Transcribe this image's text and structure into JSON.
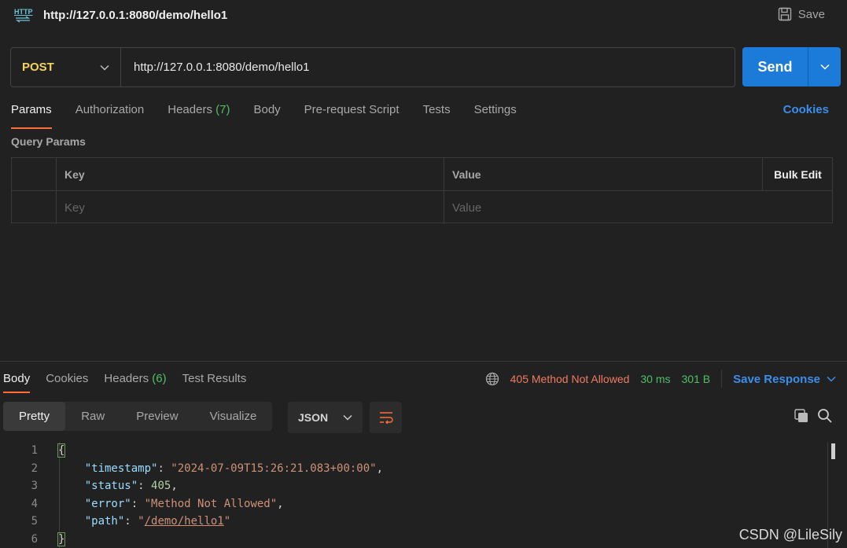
{
  "header": {
    "icon_text": "HTTP",
    "title": "http://127.0.0.1:8080/demo/hello1",
    "save_label": "Save"
  },
  "request": {
    "method": "POST",
    "url": "http://127.0.0.1:8080/demo/hello1",
    "send_label": "Send"
  },
  "req_tabs": {
    "params": "Params",
    "authorization": "Authorization",
    "headers": "Headers",
    "headers_count": "(7)",
    "body": "Body",
    "prerequest": "Pre-request Script",
    "tests": "Tests",
    "settings": "Settings"
  },
  "cookies_label": "Cookies",
  "query_params": {
    "title": "Query Params",
    "col_key": "Key",
    "col_value": "Value",
    "bulk_edit": "Bulk Edit",
    "key_placeholder": "Key",
    "value_placeholder": "Value"
  },
  "response": {
    "tabs": {
      "body": "Body",
      "cookies": "Cookies",
      "headers": "Headers",
      "headers_count": "(6)",
      "test_results": "Test Results"
    },
    "status": "405 Method Not Allowed",
    "time": "30 ms",
    "size": "301 B",
    "save_response": "Save Response",
    "views": {
      "pretty": "Pretty",
      "raw": "Raw",
      "preview": "Preview",
      "visualize": "Visualize"
    },
    "format": "JSON",
    "line_numbers": [
      "1",
      "2",
      "3",
      "4",
      "5",
      "6"
    ],
    "json": {
      "open": "{",
      "k1": "\"timestamp\"",
      "v1": "\"2024-07-09T15:26:21.083+00:00\"",
      "k2": "\"status\"",
      "v2": "405",
      "k3": "\"error\"",
      "v3": "\"Method Not Allowed\"",
      "k4": "\"path\"",
      "v4_q1": "\"",
      "v4_path": "/demo/hello1",
      "v4_q2": "\"",
      "close": "}"
    }
  },
  "watermark": "CSDN @LileSily",
  "colors": {
    "accent_orange": "#ff6c37",
    "send_blue": "#1c7bd9",
    "link_blue": "#3b8eea",
    "method_yellow": "#f3d35c",
    "status_red": "#f07a62",
    "ok_green": "#4fbf66"
  }
}
